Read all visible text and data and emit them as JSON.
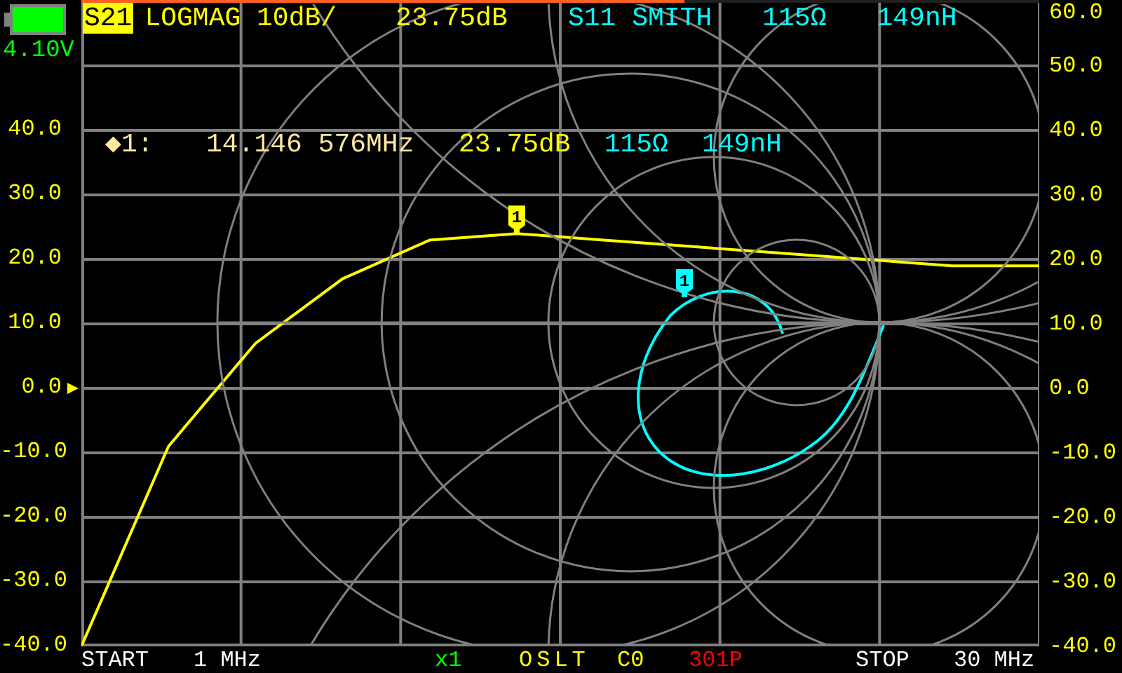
{
  "battery": {
    "voltage": "4.10V"
  },
  "sweep_progress": {
    "level": 0.63
  },
  "traces": [
    {
      "channel": "S21",
      "format": "LOGMAG 10dB/",
      "readings": [
        "23.75dB"
      ],
      "active": true,
      "color": "#ffff00"
    },
    {
      "channel": "S11",
      "format": "SMITH",
      "readings": [
        "115Ω",
        "149nH"
      ],
      "active": false,
      "color": "#00ffff"
    }
  ],
  "marker": {
    "symbol": "◆1:",
    "frequency": "14.146 576MHz",
    "readings": [
      {
        "color": "#ffff00",
        "text": "23.75dB"
      },
      {
        "color": "#00ffff",
        "text": "115Ω"
      },
      {
        "color": "#00ffff",
        "text": "149nH"
      }
    ],
    "flags": [
      {
        "color": "#ffff00",
        "label": "1"
      },
      {
        "color": "#00ffff",
        "label": "1"
      }
    ]
  },
  "left_axis": [
    "40.0",
    "30.0",
    "20.0",
    "10.0",
    "0.0",
    "-10.0",
    "-20.0",
    "-30.0",
    "-40.0"
  ],
  "plot": {
    "chart_data": {
      "type": "line",
      "grid": true,
      "categories": [
        null,
        null,
        null,
        null,
        null,
        null,
        null,
        null,
        null,
        null,
        null,
        null
      ],
      "ylim": [
        -40,
        60
      ],
      "yticks": [
        {
          "value": -40,
          "label": "-40.0"
        },
        {
          "value": -30,
          "label": "-30.0"
        },
        {
          "value": -20,
          "label": "-20.0"
        },
        {
          "value": -10,
          "label": "-10.0"
        },
        {
          "value": 0,
          "label": "0.0"
        },
        {
          "value": 10,
          "label": "10.0"
        },
        {
          "value": 20,
          "label": "20.0"
        },
        {
          "value": 30,
          "label": "30.0"
        },
        {
          "value": 40,
          "label": "40.0"
        },
        {
          "value": 50,
          "label": "50.0"
        },
        {
          "value": 60,
          "label": "60.0"
        }
      ],
      "series": [
        {
          "color": "#ffff00",
          "values": [
            -40,
            -9,
            7,
            17,
            23,
            24,
            23,
            22,
            21,
            20,
            19,
            19
          ]
        }
      ]
    }
  },
  "footer": {
    "start_label": "START",
    "start_value": "1 MHz",
    "averaging": "x1",
    "calibration": "OSLT",
    "cal_slot": "C0",
    "points": "301P",
    "stop_label": "STOP",
    "stop_value": "30 MHz"
  }
}
